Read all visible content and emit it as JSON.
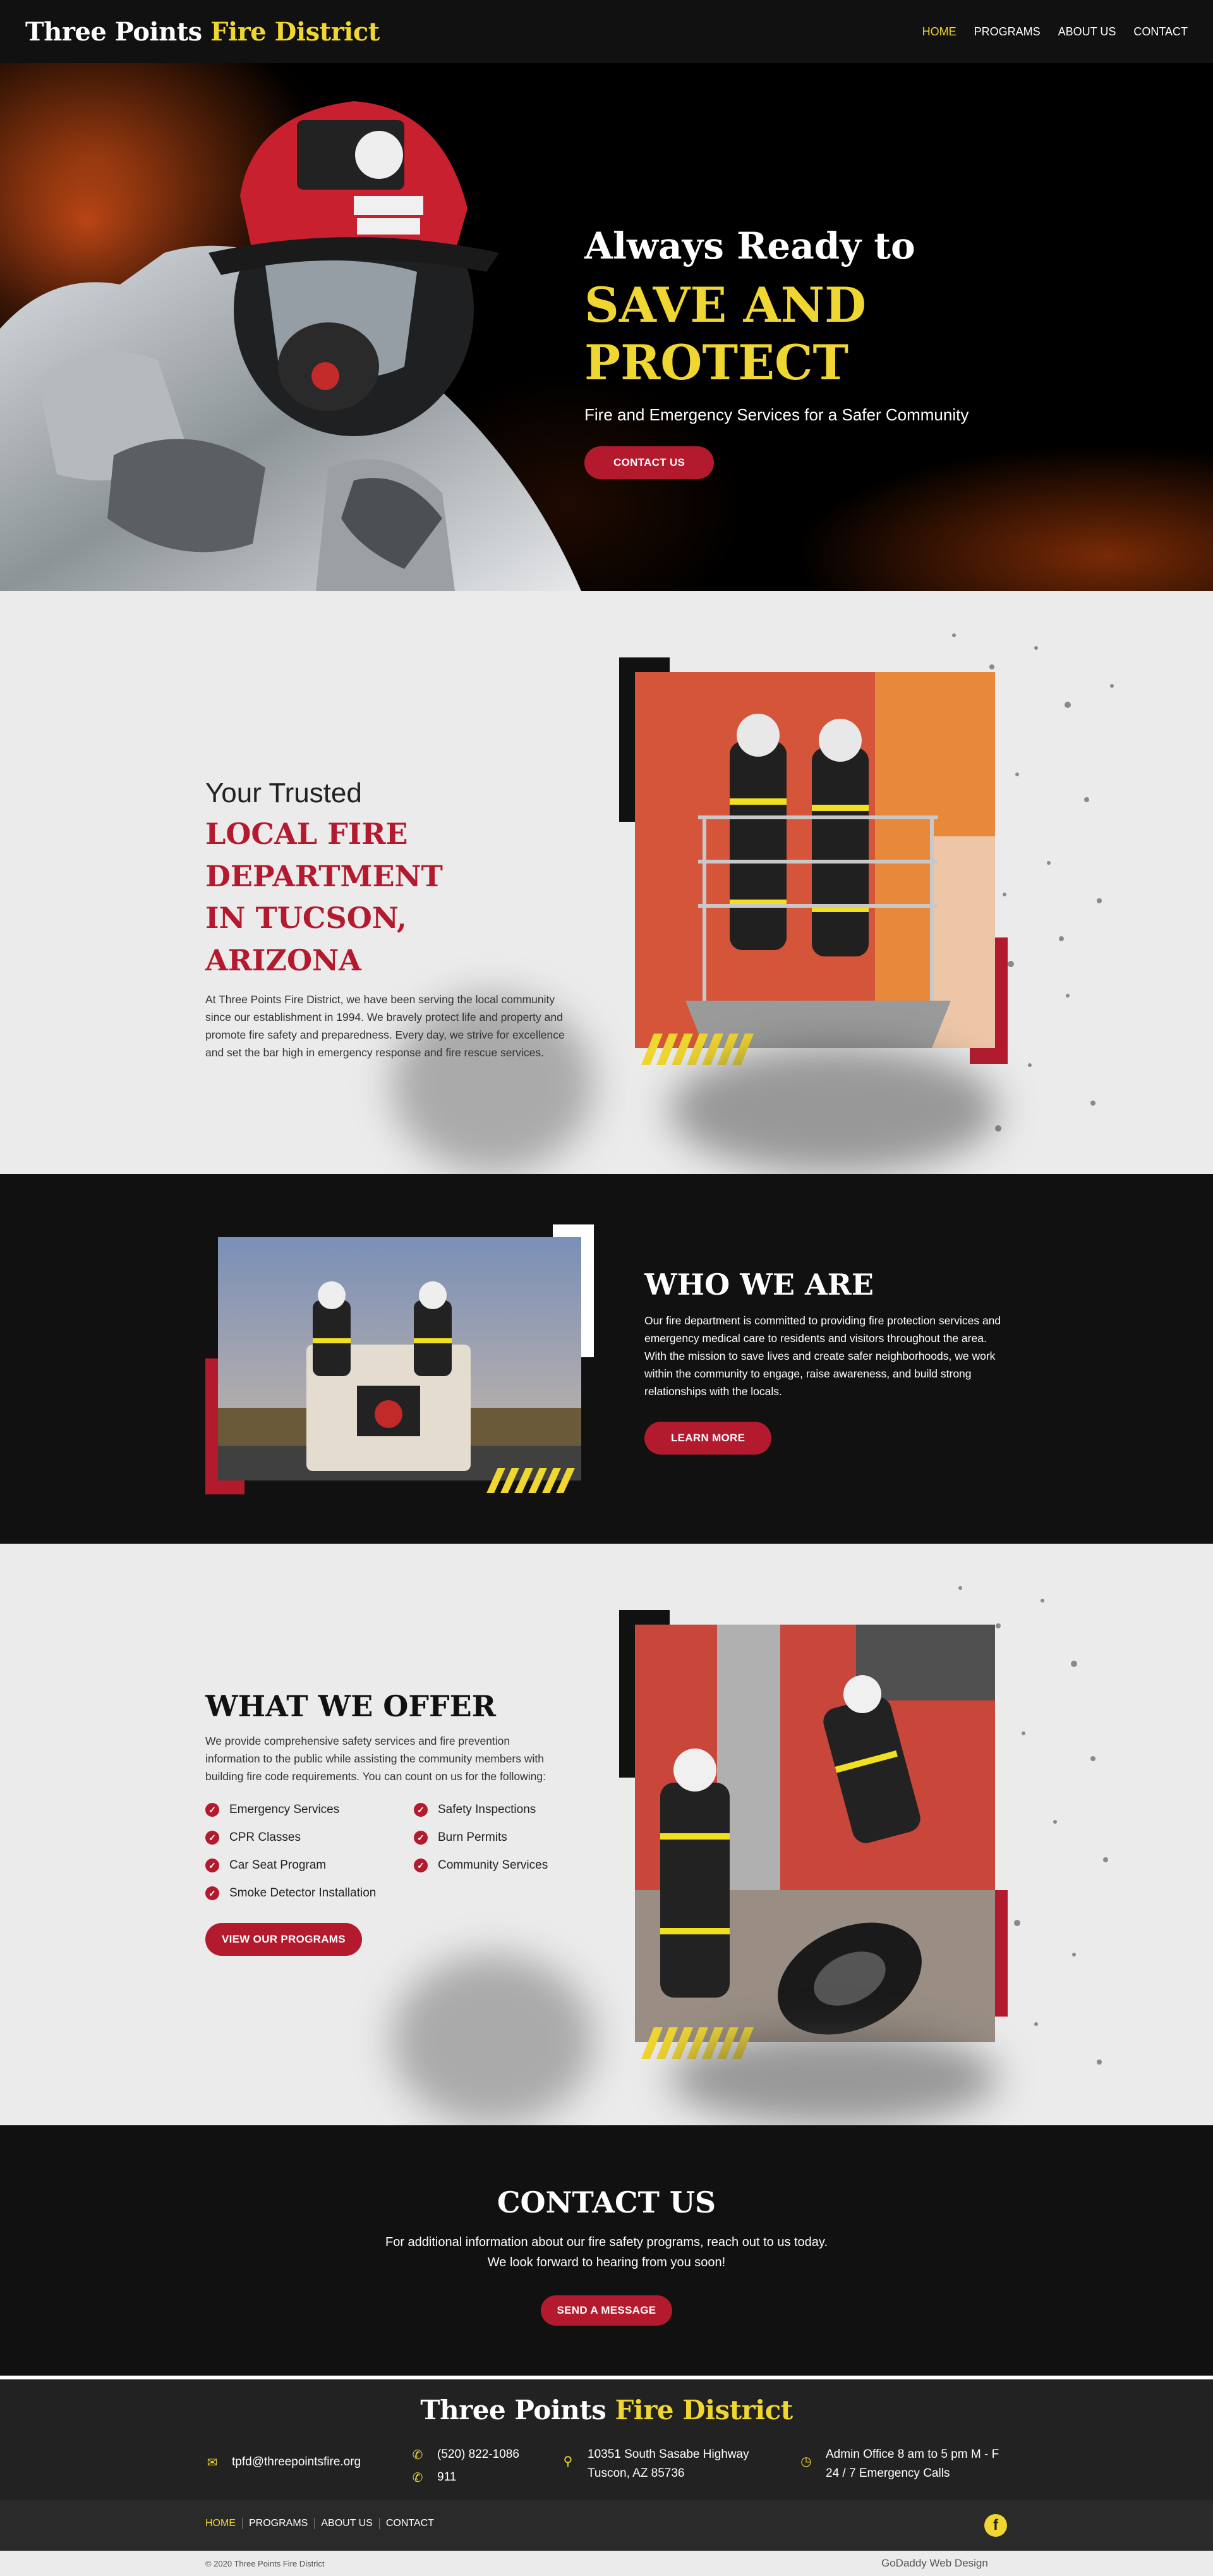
{
  "header": {
    "logo_main": "Three Points",
    "logo_accent": "Fire District",
    "nav": [
      "HOME",
      "PROGRAMS",
      "ABOUT US",
      "CONTACT"
    ]
  },
  "hero": {
    "line1": "Always Ready to",
    "line2": "SAVE AND PROTECT",
    "subtitle": "Fire and Emergency Services for a Safer Community",
    "cta": "CONTACT US"
  },
  "trusted": {
    "kicker": "Your Trusted",
    "title_line1": "LOCAL FIRE DEPARTMENT",
    "title_line2": "IN TUCSON, ARIZONA",
    "body": "At Three Points Fire District, we have been serving the local community since our establishment in 1994. We bravely protect life and property and promote fire safety and preparedness. Every day, we strive for excellence and set the bar high in emergency response and fire rescue services."
  },
  "who": {
    "title": "WHO WE ARE",
    "body": "Our fire department is committed to providing fire protection services and emergency medical care to residents and visitors throughout the area. With the mission to save lives and create safer neighborhoods, we work within the community to engage, raise awareness, and build strong relationships with the locals.",
    "cta": "LEARN MORE"
  },
  "offer": {
    "title": "WHAT WE OFFER",
    "body": "We provide comprehensive safety services and fire prevention information to the public while assisting the community members with building fire code requirements. You can count on us for the following:",
    "items": [
      "Emergency Services",
      "Safety Inspections",
      "CPR Classes",
      "Burn Permits",
      "Car Seat Program",
      "Community Services",
      "Smoke Detector Installation"
    ],
    "cta": "VIEW OUR PROGRAMS"
  },
  "contact": {
    "title": "CONTACT US",
    "body": "For additional information about our fire safety programs, reach out to us today. We look forward to hearing from you soon!",
    "cta": "SEND A MESSAGE"
  },
  "footer": {
    "email": "tpfd@threepointsfire.org",
    "phone1": "(520) 822-1086",
    "phone2": "911",
    "address1": "10351 South Sasabe Highway",
    "address2": "Tuscon, AZ 85736",
    "hours1": "Admin Office 8 am to 5 pm M - F",
    "hours2": "24 / 7 Emergency Calls",
    "nav": [
      "HOME",
      "PROGRAMS",
      "ABOUT US",
      "CONTACT"
    ],
    "facebook_glyph": "f",
    "copyright": "© 2020 Three Points Fire District",
    "credit": "GoDaddy Web Design"
  },
  "colors": {
    "accent_yellow": "#f0d630",
    "accent_red": "#b41a2e",
    "dark_bg": "#111111"
  }
}
